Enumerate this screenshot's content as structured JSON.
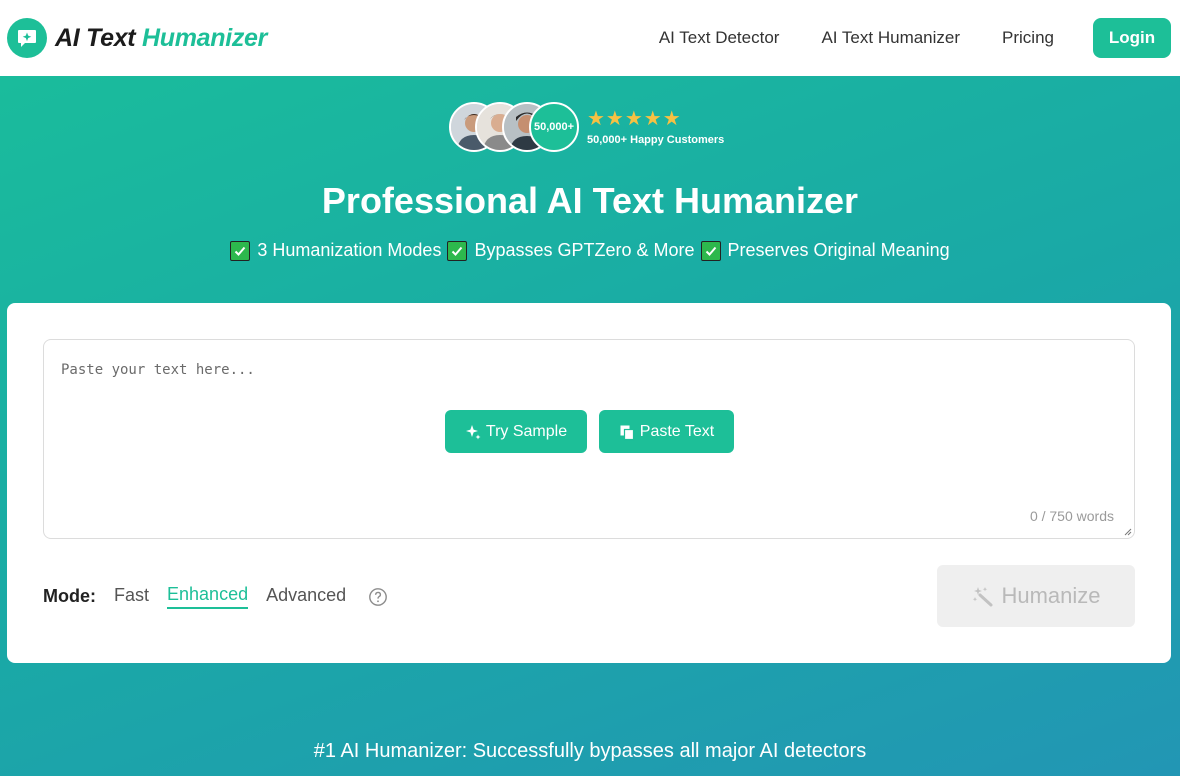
{
  "brand": {
    "name_part1": "AI Text",
    "name_part2": "Humanizer",
    "accent_color": "#1dbf98"
  },
  "nav": {
    "links": [
      "AI Text Detector",
      "AI Text Humanizer",
      "Pricing"
    ],
    "login_label": "Login"
  },
  "social_proof": {
    "count_badge": "50,000+",
    "stars": "★★★★★",
    "rating": 5,
    "customers_text": "50,000+ Happy Customers"
  },
  "hero": {
    "title": "Professional AI Text Humanizer",
    "features": [
      "3 Humanization Modes",
      "Bypasses GPTZero & More",
      "Preserves Original Meaning"
    ]
  },
  "editor": {
    "placeholder": "Paste your text here...",
    "value": "",
    "try_sample_label": "Try Sample",
    "paste_text_label": "Paste Text",
    "word_count": "0 / 750 words"
  },
  "mode": {
    "label": "Mode:",
    "options": [
      "Fast",
      "Enhanced",
      "Advanced"
    ],
    "selected": "Enhanced"
  },
  "humanize_label": "Humanize",
  "tagline": "#1 AI Humanizer: Successfully bypasses all major AI detectors"
}
